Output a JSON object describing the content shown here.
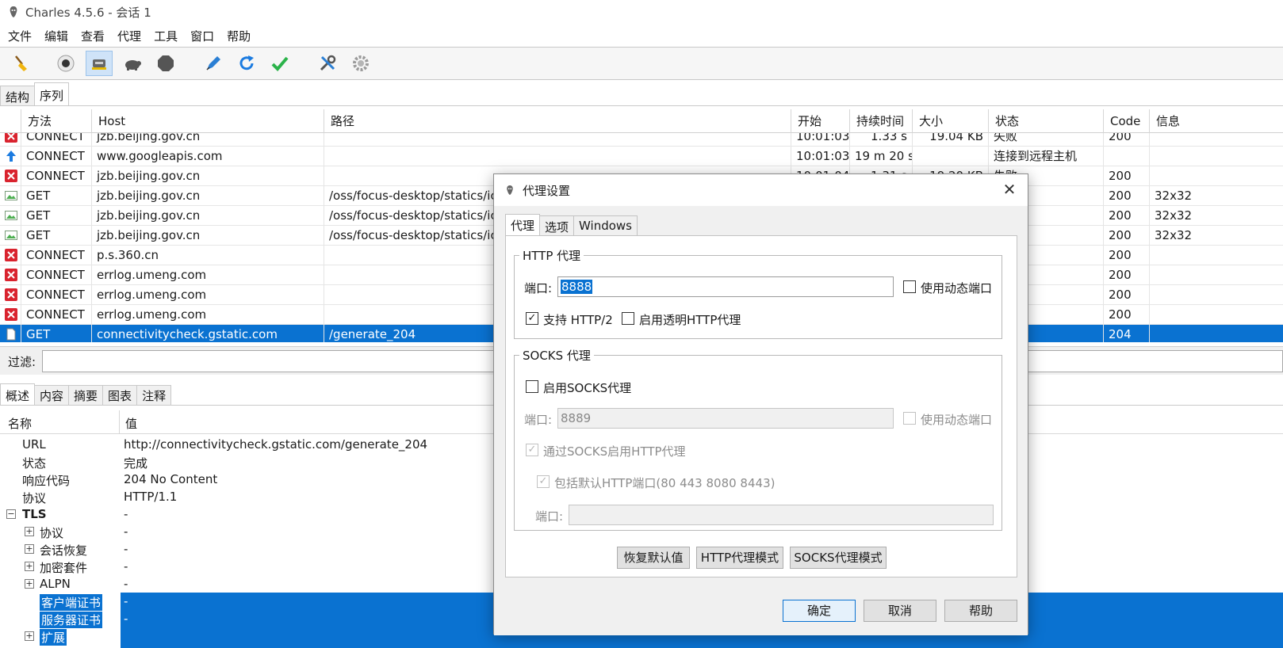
{
  "window": {
    "title": "Charles 4.5.6 - 会话 1"
  },
  "menu": [
    "文件",
    "编辑",
    "查看",
    "代理",
    "工具",
    "窗口",
    "帮助"
  ],
  "toolbar": [
    {
      "name": "broom-icon"
    },
    {
      "name": "record-icon"
    },
    {
      "name": "throttle-icon"
    },
    {
      "name": "turtle-icon"
    },
    {
      "name": "stop-icon"
    },
    {
      "name": "pen-icon"
    },
    {
      "name": "refresh-icon"
    },
    {
      "name": "check-icon"
    },
    {
      "name": "tools-icon"
    },
    {
      "name": "settings-gear-icon"
    }
  ],
  "view_tabs": [
    "结构",
    "序列"
  ],
  "table": {
    "columns": [
      "方法",
      "Host",
      "路径",
      "开始",
      "持续时间",
      "大小",
      "状态",
      "Code",
      "信息"
    ],
    "rows": [
      {
        "icon": "error",
        "method": "CONNECT",
        "host": "jzb.beijing.gov.cn",
        "path": "",
        "start": "10:01:03",
        "duration": "1.33 s",
        "size": "19.04 KB",
        "status": "失败",
        "code": "200",
        "info": ""
      },
      {
        "icon": "upload",
        "method": "CONNECT",
        "host": "www.googleapis.com",
        "path": "",
        "start": "10:01:03",
        "duration": "19 m 20 s",
        "size": "",
        "status": "连接到远程主机",
        "code": "",
        "info": ""
      },
      {
        "icon": "error",
        "method": "CONNECT",
        "host": "jzb.beijing.gov.cn",
        "path": "",
        "start": "10:01:04",
        "duration": "1.31 s",
        "size": "19.20 KB",
        "status": "失败",
        "code": "200",
        "info": ""
      },
      {
        "icon": "image",
        "method": "GET",
        "host": "jzb.beijing.gov.cn",
        "path": "/oss/focus-desktop/statics/ic",
        "start": "",
        "duration": "",
        "size": "",
        "status": "",
        "code": "200",
        "info": "32x32"
      },
      {
        "icon": "image",
        "method": "GET",
        "host": "jzb.beijing.gov.cn",
        "path": "/oss/focus-desktop/statics/ic",
        "start": "",
        "duration": "",
        "size": "",
        "status": "",
        "code": "200",
        "info": "32x32"
      },
      {
        "icon": "image",
        "method": "GET",
        "host": "jzb.beijing.gov.cn",
        "path": "/oss/focus-desktop/statics/ic",
        "start": "",
        "duration": "",
        "size": "",
        "status": "",
        "code": "200",
        "info": "32x32"
      },
      {
        "icon": "error",
        "method": "CONNECT",
        "host": "p.s.360.cn",
        "path": "",
        "start": "",
        "duration": "",
        "size": "",
        "status": "",
        "code": "200",
        "info": ""
      },
      {
        "icon": "error",
        "method": "CONNECT",
        "host": "errlog.umeng.com",
        "path": "",
        "start": "",
        "duration": "",
        "size": "",
        "status": "",
        "code": "200",
        "info": ""
      },
      {
        "icon": "error",
        "method": "CONNECT",
        "host": "errlog.umeng.com",
        "path": "",
        "start": "",
        "duration": "",
        "size": "",
        "status": "",
        "code": "200",
        "info": ""
      },
      {
        "icon": "error",
        "method": "CONNECT",
        "host": "errlog.umeng.com",
        "path": "",
        "start": "",
        "duration": "",
        "size": "",
        "status": "",
        "code": "200",
        "info": ""
      },
      {
        "icon": "doc",
        "method": "GET",
        "host": "connectivitycheck.gstatic.com",
        "path": "/generate_204",
        "start": "",
        "duration": "",
        "size": "",
        "status": "",
        "code": "204",
        "info": "",
        "selected": true
      }
    ]
  },
  "filter": {
    "label": "过滤:",
    "value": ""
  },
  "detail_tabs": [
    "概述",
    "内容",
    "摘要",
    "图表",
    "注释"
  ],
  "props": {
    "col_name": "名称",
    "col_value": "值",
    "rows": [
      {
        "name": "URL",
        "value": "http://connectivitycheck.gstatic.com/generate_204"
      },
      {
        "name": "状态",
        "value": "完成"
      },
      {
        "name": "响应代码",
        "value": "204 No Content"
      },
      {
        "name": "协议",
        "value": "HTTP/1.1"
      },
      {
        "name": "TLS",
        "value": "-",
        "expander": "−"
      },
      {
        "name": "协议",
        "value": "-",
        "expander": "+"
      },
      {
        "name": "会话恢复",
        "value": "-",
        "expander": "+"
      },
      {
        "name": "加密套件",
        "value": "-",
        "expander": "+"
      },
      {
        "name": "ALPN",
        "value": "-",
        "expander": "+"
      },
      {
        "name": "客户端证书",
        "value": "-",
        "selected": true
      },
      {
        "name": "服务器证书",
        "value": "-",
        "selected": true
      },
      {
        "name": "扩展",
        "value": "",
        "expander": "+",
        "selected": true
      }
    ]
  },
  "dialog": {
    "title": "代理设置",
    "close": "✕",
    "tabs": [
      "代理",
      "选项",
      "Windows"
    ],
    "http_group": {
      "title": "HTTP 代理",
      "port_label": "端口:",
      "port_value": "8888",
      "dynamic_port_label": "使用动态端口",
      "dynamic_port_checked": false,
      "http2_label": "支持 HTTP/2",
      "http2_checked": true,
      "transparent_label": "启用透明HTTP代理",
      "transparent_checked": false
    },
    "socks_group": {
      "title": "SOCKS 代理",
      "enable_label": "启用SOCKS代理",
      "enable_checked": false,
      "port_label": "端口:",
      "port_value": "8889",
      "dynamic_port_label": "使用动态端口",
      "via_socks_label": "通过SOCKS启用HTTP代理",
      "via_socks_checked": true,
      "include_default_label": "包括默认HTTP端口(80 443 8080 8443)",
      "include_default_checked": true,
      "ports_label": "端口:",
      "ports_value": ""
    },
    "mode_buttons": [
      "恢复默认值",
      "HTTP代理模式",
      "SOCKS代理模式"
    ],
    "ok": "确定",
    "cancel": "取消",
    "help": "帮助"
  },
  "colors": {
    "selection": "#0a72d1",
    "error": "#d9232e",
    "upload": "#1b7be0"
  }
}
